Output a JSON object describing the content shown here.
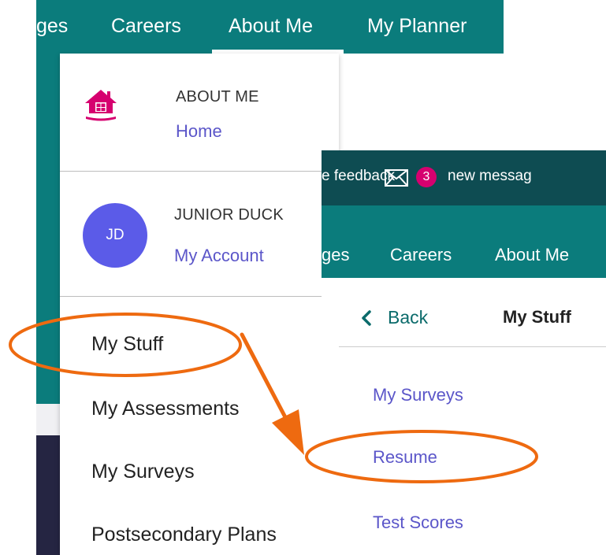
{
  "back_nav": {
    "items": [
      "ges",
      "Careers",
      "About Me",
      "My Planner"
    ]
  },
  "dropdown": {
    "about_header": "ABOUT ME",
    "home_link": "Home",
    "user_name": "JUNIOR DUCK",
    "avatar_initials": "JD",
    "account_link": "My Account",
    "items": [
      "My Stuff",
      "My Assessments",
      "My Surveys",
      "Postsecondary Plans"
    ]
  },
  "front": {
    "feedback_text": "e feedback",
    "message_count": "3",
    "message_text": "new messag",
    "nav_items": [
      "ges",
      "Careers",
      "About Me"
    ],
    "back_label": "Back",
    "page_title": "My Stuff",
    "list_items": [
      "My Surveys",
      "Resume",
      "Test Scores"
    ]
  },
  "colors": {
    "nav_teal": "#0b7c7c",
    "top_dark_teal": "#0e4c52",
    "link_purple": "#5b56c9",
    "avatar": "#5b5be8",
    "badge": "#d6006f",
    "home_icon": "#d6006f",
    "annotation_orange": "#ee6a10"
  }
}
